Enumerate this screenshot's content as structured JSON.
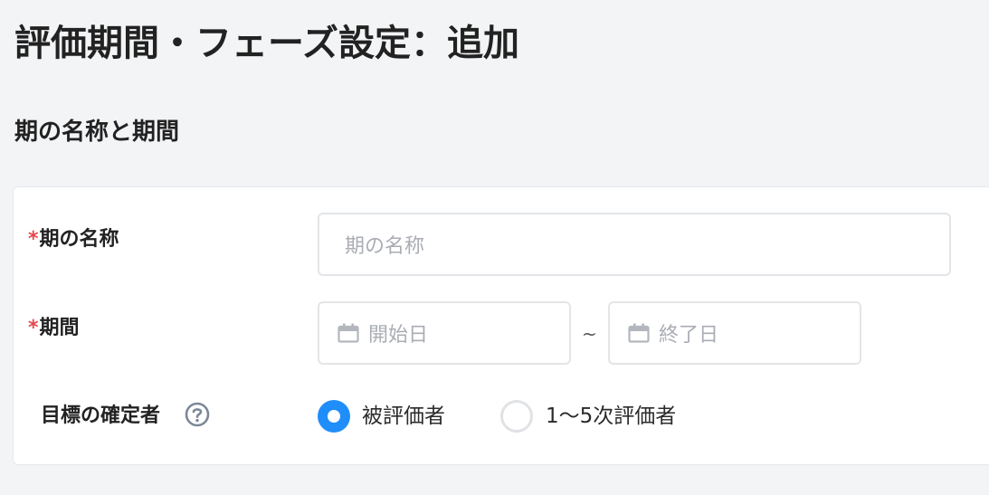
{
  "page": {
    "title": "評価期間・フェーズ設定：追加",
    "section_title": "期の名称と期間"
  },
  "form": {
    "required_mark": "*",
    "name_label": "期の名称",
    "name_placeholder": "期の名称",
    "period_label": "期間",
    "start_placeholder": "開始日",
    "range_separator": "~",
    "end_placeholder": "終了日",
    "confirmer_label": "目標の確定者",
    "confirmer_options": [
      {
        "label": "被評価者",
        "selected": true
      },
      {
        "label": "1〜5次評価者",
        "selected": false
      }
    ]
  },
  "icons": {
    "calendar": "calendar-icon",
    "help": "help-circle-icon"
  },
  "colors": {
    "accent": "#1f8efa",
    "required": "#e5484d",
    "background": "#f3f4f6"
  }
}
